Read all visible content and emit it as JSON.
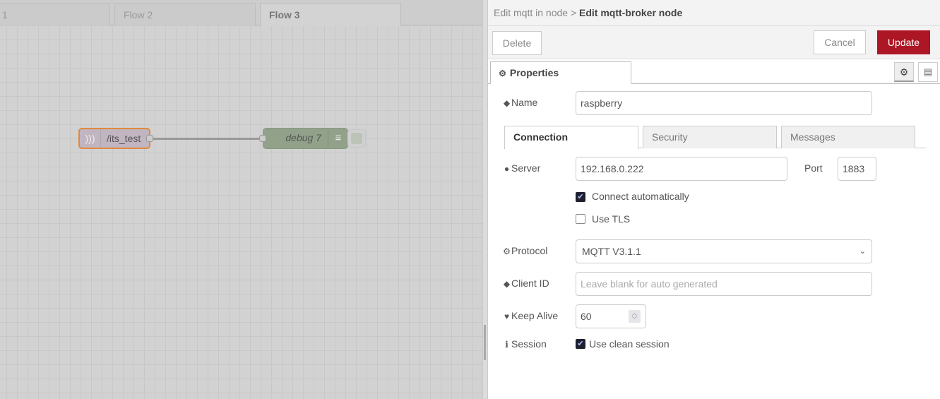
{
  "workspace": {
    "tabs": [
      {
        "label": "1"
      },
      {
        "label": "Flow 2"
      },
      {
        "label": "Flow 3",
        "active": true
      }
    ],
    "nodes": [
      {
        "type": "mqtt-in",
        "label": "/its_test",
        "icon": "wifi-icon",
        "color": "#c0b5c0"
      },
      {
        "type": "debug",
        "label": "debug 7",
        "icon": "list-icon",
        "color": "#91a18a"
      }
    ]
  },
  "dialog": {
    "breadcrumb_parent": "Edit mqtt in node",
    "breadcrumb_sep": ">",
    "title": "Edit mqtt-broker node",
    "delete_label": "Delete",
    "cancel_label": "Cancel",
    "update_label": "Update",
    "update_color": "#ad1625",
    "properties_tab": "Properties",
    "name_label": "Name",
    "name_value": "raspberry",
    "subtabs": [
      "Connection",
      "Security",
      "Messages"
    ],
    "server_label": "Server",
    "server_value": "192.168.0.222",
    "port_label": "Port",
    "port_value": "1883",
    "connect_auto_label": "Connect automatically",
    "connect_auto_checked": true,
    "tls_label": "Use TLS",
    "tls_checked": false,
    "protocol_label": "Protocol",
    "protocol_value": "MQTT V3.1.1",
    "clientid_label": "Client ID",
    "clientid_placeholder": "Leave blank for auto generated",
    "keepalive_label": "Keep Alive",
    "keepalive_value": "60",
    "session_label": "Session",
    "session_option": "Use clean session",
    "session_checked": true
  }
}
